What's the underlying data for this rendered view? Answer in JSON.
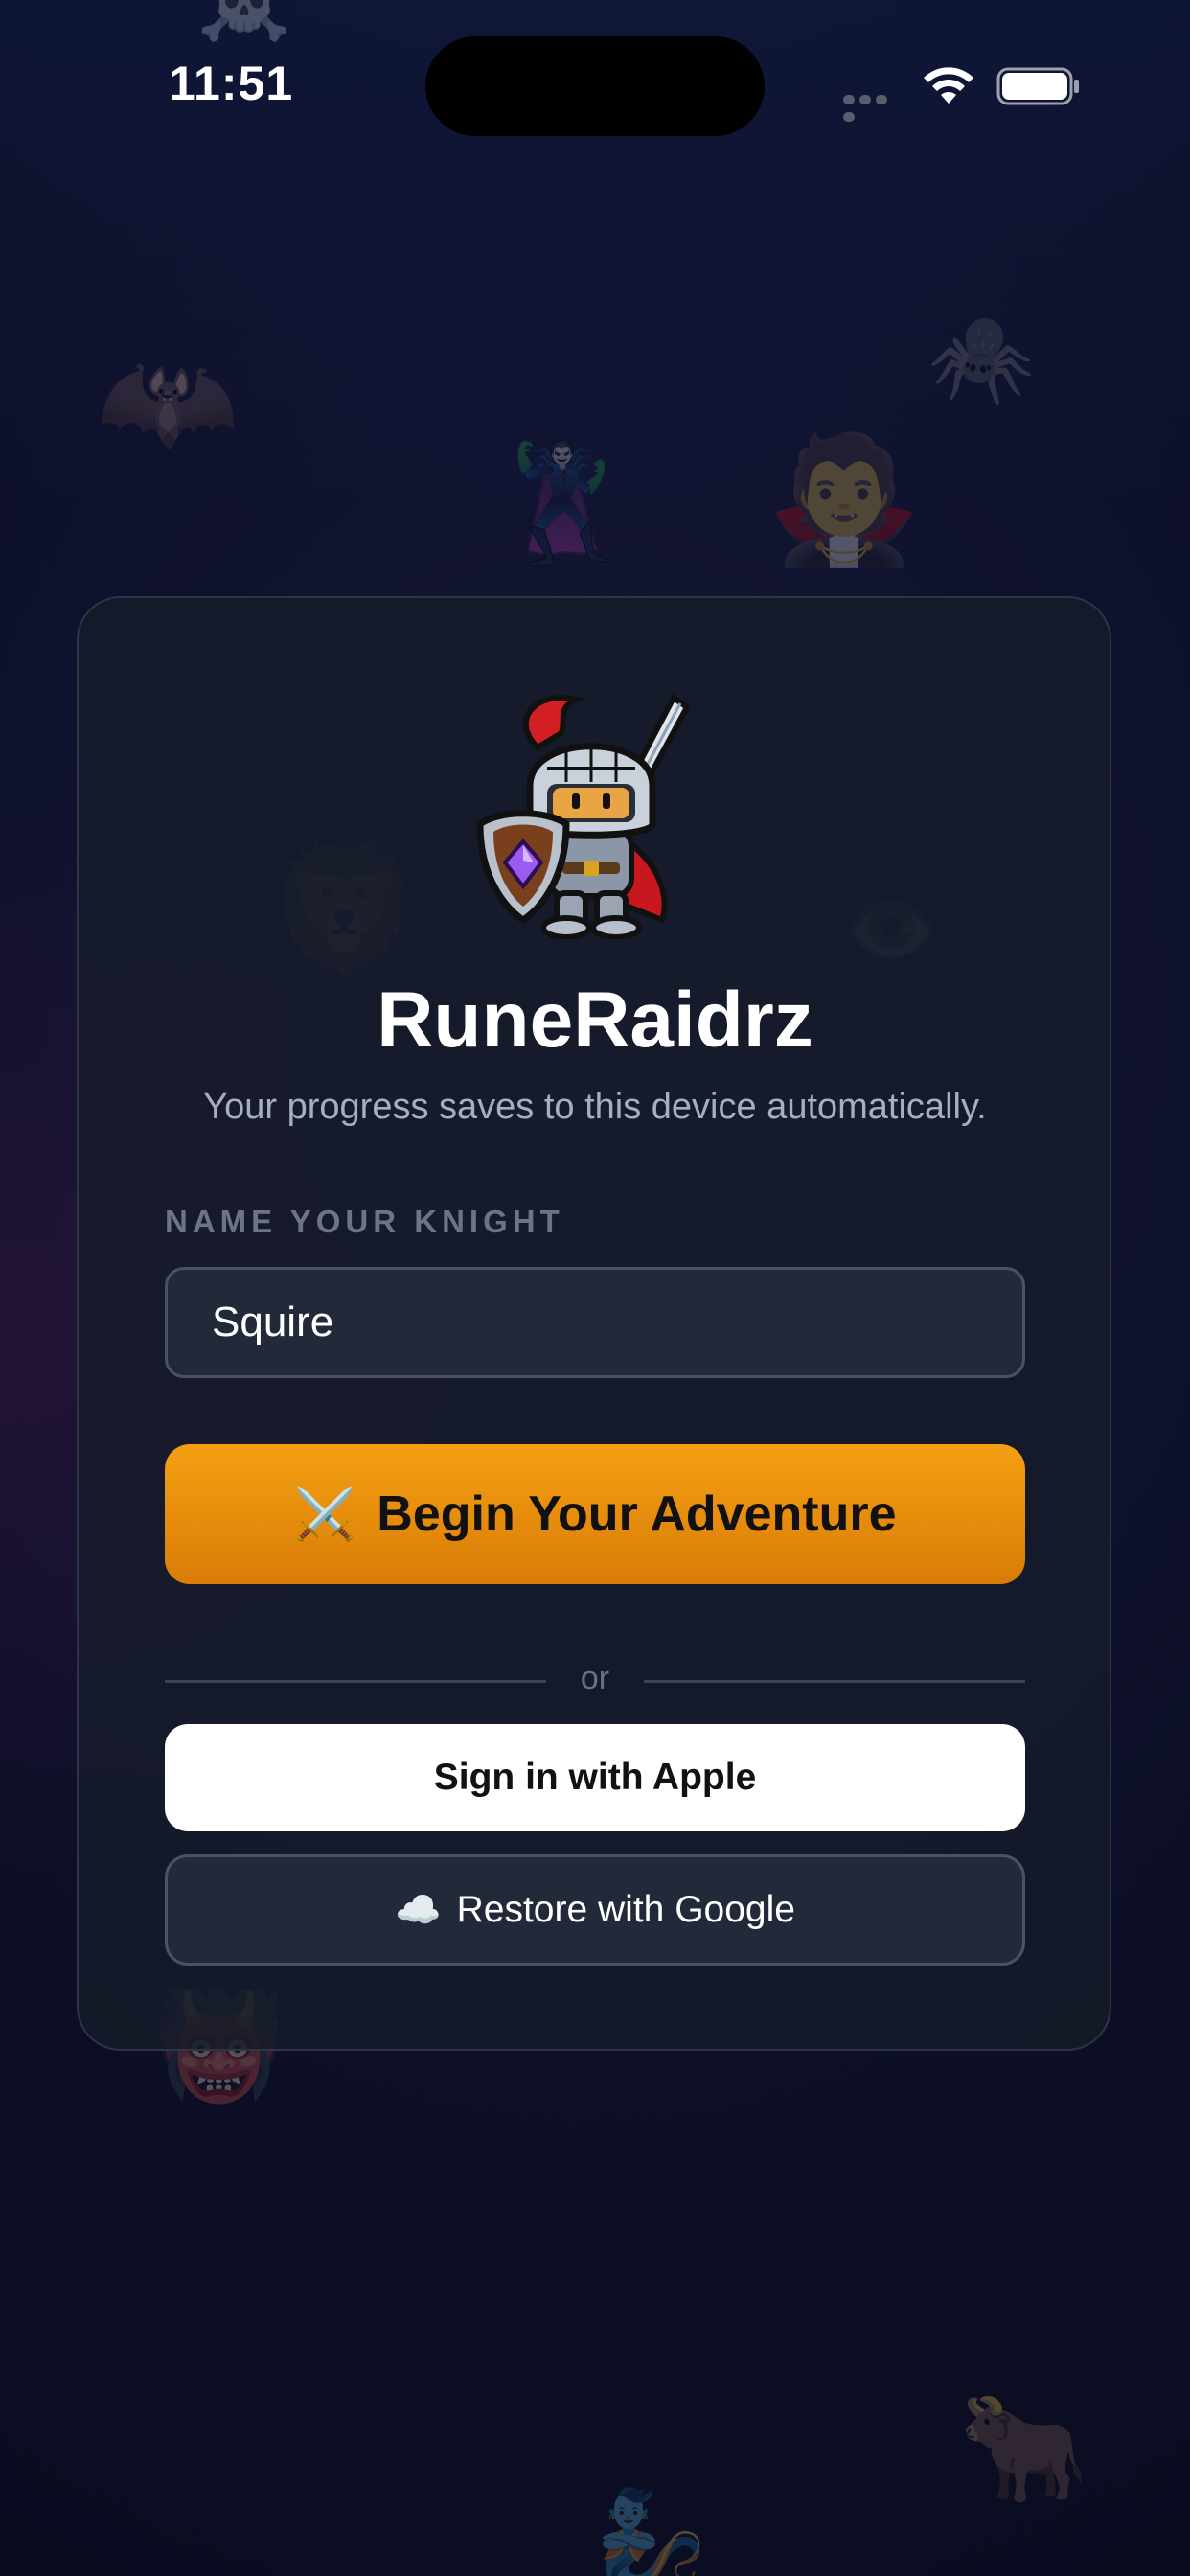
{
  "status_bar": {
    "time": "11:51"
  },
  "decorations": [
    {
      "name": "skull-crossbones-icon",
      "glyph": "☠️"
    },
    {
      "name": "bat-icon",
      "glyph": "🦇"
    },
    {
      "name": "spider-icon",
      "glyph": "🕷️"
    },
    {
      "name": "supervillain-icon",
      "glyph": "🦹"
    },
    {
      "name": "vampire-icon",
      "glyph": "🧛"
    },
    {
      "name": "lion-icon",
      "glyph": "🦁"
    },
    {
      "name": "eye-icon",
      "glyph": "👁️"
    },
    {
      "name": "ogre-icon",
      "glyph": "👹"
    },
    {
      "name": "ox-icon",
      "glyph": "🐂"
    },
    {
      "name": "genie-icon",
      "glyph": "🧞"
    }
  ],
  "login": {
    "title": "RuneRaidrz",
    "subtitle": "Your progress saves to this device automatically.",
    "name_label": "NAME YOUR KNIGHT",
    "name_value": "Squire",
    "begin_icon": "⚔️",
    "begin_label": "Begin Your Adventure",
    "divider_text": "or",
    "apple_label": "Sign in with Apple",
    "google_icon": "☁️",
    "google_label": "Restore with Google"
  },
  "colors": {
    "accent": "#f4a012",
    "background": "#0c0e26",
    "card": "#161c2a"
  }
}
